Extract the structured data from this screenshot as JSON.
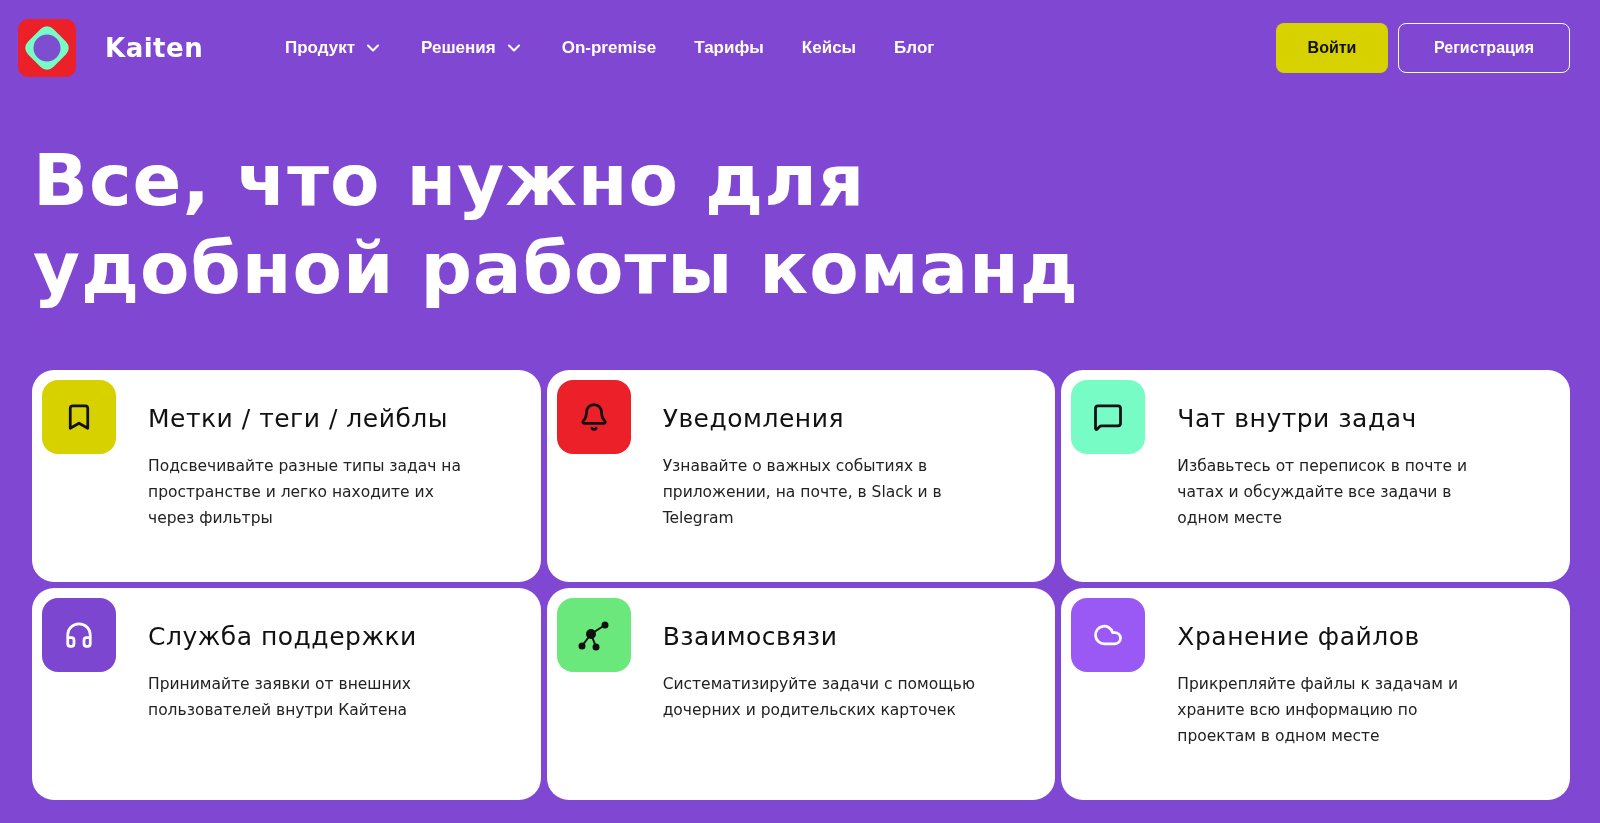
{
  "header": {
    "logo_text": "Kaiten",
    "nav": [
      {
        "label": "Продукт",
        "has_menu": true
      },
      {
        "label": "Решения",
        "has_menu": true
      },
      {
        "label": "On-premise",
        "has_menu": false
      },
      {
        "label": "Тарифы",
        "has_menu": false
      },
      {
        "label": "Кейсы",
        "has_menu": false
      },
      {
        "label": "Блог",
        "has_menu": false
      }
    ],
    "login": "Войти",
    "signup": "Регистрация"
  },
  "hero": {
    "title_lines": [
      "Все, что нужно для",
      "удобной работы команд"
    ]
  },
  "features": [
    {
      "kind": "bookmark",
      "color": "#d8d100",
      "title": "Метки / теги / лейблы",
      "text": "Подсвечивайте разные типы задач на пространстве и легко находите их через фильтры"
    },
    {
      "kind": "bell",
      "color": "#ec2028",
      "title": "Уведомления",
      "text": "Узнавайте о важных событиях в приложении, на почте, в Slack и в Telegram"
    },
    {
      "kind": "chat",
      "color": "#77fcc6",
      "title": "Чат внутри задач",
      "text": "Избавьтесь от переписок в почте и чатах и обсуждайте все задачи в одном месте"
    },
    {
      "kind": "headset",
      "color": "#7d46d1",
      "title": "Служба поддержки",
      "text": "Принимайте заявки от внешних пользователей внутри Кайтена"
    },
    {
      "kind": "network",
      "color": "#6be87b",
      "title": "Взаимосвязи",
      "text": "Систематизируйте задачи с помощью дочерних и родительских карточек"
    },
    {
      "kind": "cloud",
      "color": "#9a58f5",
      "title": "Хранение файлов",
      "text": "Прикрепляйте файлы к задачам и храните всю информацию по проектам в одном месте"
    }
  ]
}
